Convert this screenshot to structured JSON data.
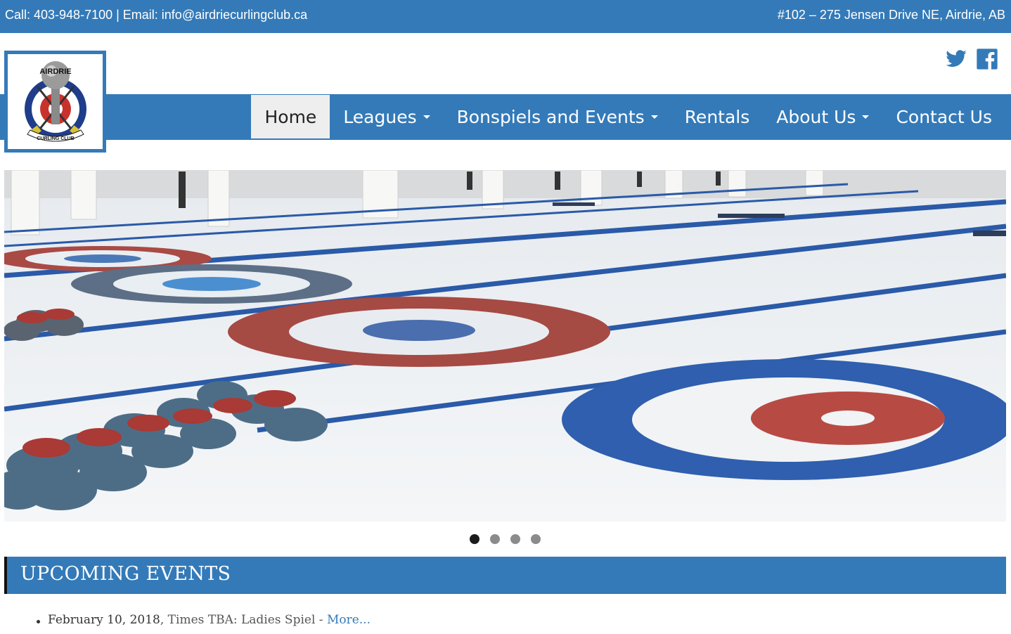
{
  "topbar": {
    "contact": "Call: 403-948-7100 | Email: info@airdriecurlingclub.ca",
    "address": "#102 – 275 Jensen Drive NE, Airdrie, AB"
  },
  "logo": {
    "top_text": "AIRDRIE",
    "bottom_text": "CURLING CLUB"
  },
  "social": {
    "icons": [
      "twitter-icon",
      "facebook-icon"
    ]
  },
  "nav": {
    "items": [
      {
        "label": "Home",
        "active": true,
        "dropdown": false
      },
      {
        "label": "Leagues",
        "dropdown": true
      },
      {
        "label": "Bonspiels and Events",
        "dropdown": true
      },
      {
        "label": "Rentals",
        "dropdown": false
      },
      {
        "label": "About Us",
        "dropdown": true
      },
      {
        "label": "Contact Us",
        "dropdown": false
      }
    ]
  },
  "slider": {
    "slide_count": 4,
    "active_index": 0
  },
  "events": {
    "heading": "UPCOMING EVENTS",
    "items": [
      {
        "date": "February 10, 2018",
        "text": ", Times TBA: Ladies Spiel - ",
        "link": "More..."
      }
    ]
  },
  "colors": {
    "brand_blue": "#347ab8",
    "nav_active_bg": "#eeeeee",
    "house_blue": "#2f5fae",
    "house_red": "#a8403b"
  }
}
